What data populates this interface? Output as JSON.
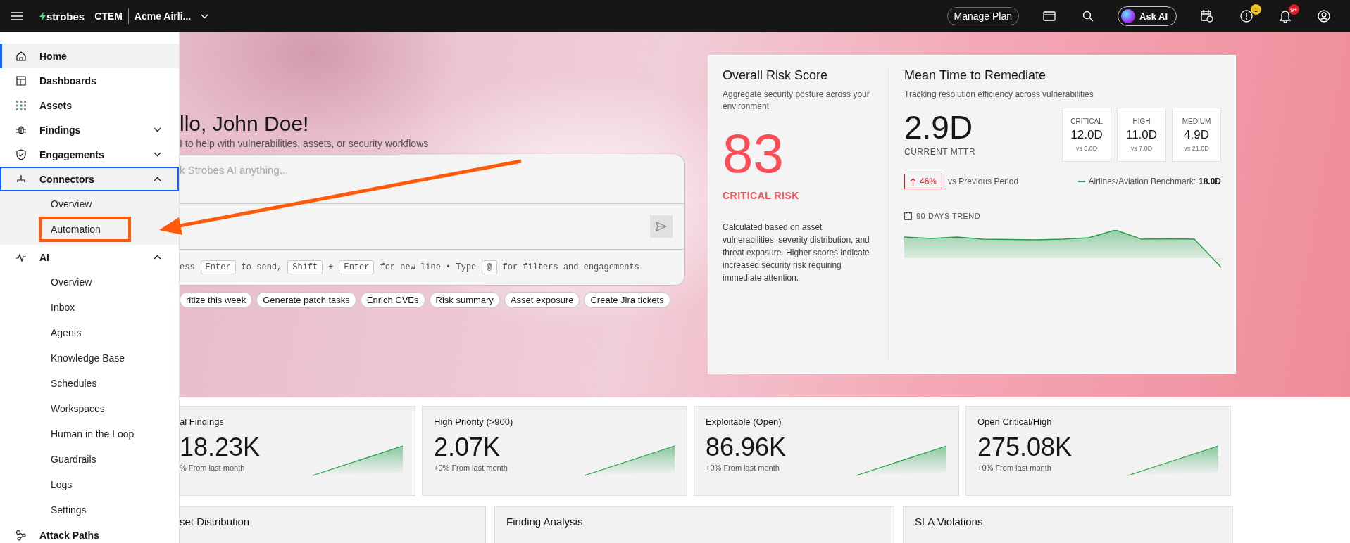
{
  "topbar": {
    "brand": "strobes",
    "product": "CTEM",
    "org": "Acme Airli...",
    "manage_plan": "Manage Plan",
    "ask_ai": "Ask AI",
    "alerts_badge": "1",
    "notifications_badge": "9+"
  },
  "sidebar": {
    "items": [
      {
        "kind": "link",
        "label": "Home",
        "selected": true,
        "focused": false
      },
      {
        "kind": "link",
        "label": "Dashboards",
        "selected": false,
        "focused": false
      },
      {
        "kind": "link",
        "label": "Assets",
        "selected": false,
        "focused": false
      },
      {
        "kind": "group",
        "label": "Findings",
        "selected": false,
        "focused": false,
        "expanded": false
      },
      {
        "kind": "group",
        "label": "Engagements",
        "selected": false,
        "focused": false,
        "expanded": false
      },
      {
        "kind": "group",
        "label": "Connectors",
        "selected": false,
        "focused": true,
        "expanded": true,
        "children": [
          {
            "label": "Overview",
            "highlighted": false
          },
          {
            "label": "Automation",
            "highlighted": true
          }
        ]
      },
      {
        "kind": "group",
        "label": "AI",
        "selected": false,
        "focused": false,
        "expanded": true,
        "children": [
          {
            "label": "Overview",
            "highlighted": false
          },
          {
            "label": "Inbox",
            "highlighted": false
          },
          {
            "label": "Agents",
            "highlighted": false
          },
          {
            "label": "Knowledge Base",
            "highlighted": false
          },
          {
            "label": "Schedules",
            "highlighted": false
          },
          {
            "label": "Workspaces",
            "highlighted": false
          },
          {
            "label": "Human in the Loop",
            "highlighted": false
          },
          {
            "label": "Guardrails",
            "highlighted": false
          },
          {
            "label": "Logs",
            "highlighted": false
          },
          {
            "label": "Settings",
            "highlighted": false
          }
        ]
      },
      {
        "kind": "link",
        "label": "Attack Paths",
        "selected": false,
        "focused": false
      }
    ]
  },
  "hero": {
    "greeting": "llo, John Doe!",
    "subtitle": "I to help with vulnerabilities, assets, or security workflows",
    "chat": {
      "placeholder": "k Strobes AI anything...",
      "hint": [
        {
          "kind": "text",
          "text": "ess"
        },
        {
          "kind": "key",
          "text": "Enter"
        },
        {
          "kind": "text",
          "text": "to send,"
        },
        {
          "kind": "key",
          "text": "Shift"
        },
        {
          "kind": "text",
          "text": "+"
        },
        {
          "kind": "key",
          "text": "Enter"
        },
        {
          "kind": "text",
          "text": "for new line • Type"
        },
        {
          "kind": "key",
          "text": "@"
        },
        {
          "kind": "text",
          "text": "for filters and engagements"
        }
      ]
    },
    "suggestions": [
      "ritize this week",
      "Generate patch tasks",
      "Enrich CVEs",
      "Risk summary",
      "Asset exposure",
      "Create Jira tickets"
    ]
  },
  "risk": {
    "title": "Overall Risk Score",
    "subtitle": "Aggregate security posture across your environment",
    "score": "83",
    "label": "CRITICAL RISK",
    "description": "Calculated based on asset vulnerabilities, severity distribution, and threat exposure. Higher scores indicate increased security risk requiring immediate attention."
  },
  "mttr": {
    "title": "Mean Time to Remediate",
    "subtitle": "Tracking resolution efficiency across vulnerabilities",
    "value": "2.9D",
    "value_label": "CURRENT MTTR",
    "severities": [
      {
        "label": "CRITICAL",
        "value": "12.0D",
        "compare": "vs 3.0D"
      },
      {
        "label": "HIGH",
        "value": "11.0D",
        "compare": "vs 7.0D"
      },
      {
        "label": "MEDIUM",
        "value": "4.9D",
        "compare": "vs 21.0D"
      }
    ],
    "change": "46%",
    "change_label": "vs Previous Period",
    "benchmark_label": "Airlines/Aviation Benchmark:",
    "benchmark_value": "18.0D",
    "trend_title": "90-DAYS TREND"
  },
  "stats": [
    {
      "title": "al Findings",
      "value": "18.23K",
      "change": "% From last month"
    },
    {
      "title": "High Priority (>900)",
      "value": "2.07K",
      "change": "+0% From last month"
    },
    {
      "title": "Exploitable (Open)",
      "value": "86.96K",
      "change": "+0% From last month"
    },
    {
      "title": "Open Critical/High",
      "value": "275.08K",
      "change": "+0% From last month"
    }
  ],
  "panels": [
    "set Distribution",
    "Finding Analysis",
    "SLA Violations"
  ]
}
